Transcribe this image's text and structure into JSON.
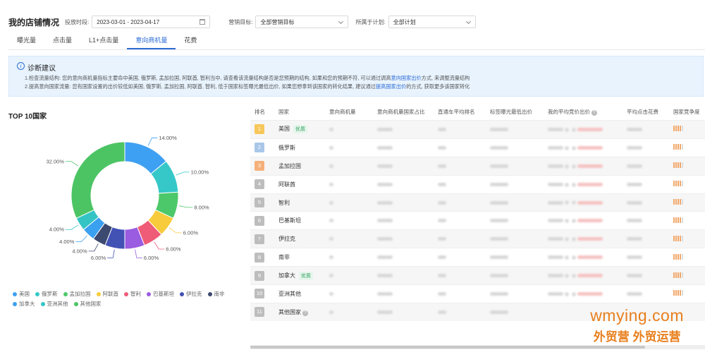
{
  "header": {
    "title": "我的店铺情况",
    "date_label": "投放时段:",
    "date_range": "2023-03-01 - 2023-04-17",
    "goal_label": "营销目标:",
    "goal_value": "全部营销目标",
    "plan_label": "所属于计划:",
    "plan_value": "全部计划"
  },
  "tabs": [
    {
      "label": "曝光量",
      "active": false
    },
    {
      "label": "点击量",
      "active": false
    },
    {
      "label": "L1+点击量",
      "active": false
    },
    {
      "label": "意向商机量",
      "active": true
    },
    {
      "label": "花费",
      "active": false
    }
  ],
  "alert": {
    "title": "诊断建议",
    "line1_a": "1.检查流量结构: 您的意向商机量指标主要命中美国, 俄罗斯, 孟加拉国, 阿联酋, 智利当中, 请查看该流量结构是否是您预期的结构, 如果和您的预期不符, 可以通过调高",
    "line1_link": "意向国家出价",
    "line1_b": "方式, 来调整流量结构",
    "line2_a": "2.提高意向国家流量: 您有国家设置的出价较低如美国, 俄罗斯, 孟加拉国, 阿联酋, 智利, 低于国家标签曝光最低出价, 如果您想拿到该国家的转化结果, 建议通过",
    "line2_link": "提高国家出价",
    "line2_b": "的方式, 获取更多该国家转化"
  },
  "chart_title": "TOP 10国家",
  "chart_data": {
    "type": "pie",
    "donut": true,
    "categories": [
      "美国",
      "俄罗斯",
      "孟加拉国",
      "阿联酋",
      "智利",
      "巴基斯坦",
      "伊拉克",
      "南非",
      "加拿大",
      "亚洲其他",
      "其他国家"
    ],
    "values": [
      14,
      10,
      8,
      6,
      6,
      6,
      6,
      4,
      4,
      4,
      32
    ],
    "labels": [
      "14.00%",
      "10.00%",
      "8.00%",
      "6.00%",
      "6.00%",
      "6.00%",
      "6.00%",
      "4.00%",
      "4.00%",
      "4.00%",
      "32.00%"
    ],
    "colors": [
      "#3ea0f3",
      "#36c8c8",
      "#4cc86a",
      "#f8cb3c",
      "#ee5c78",
      "#9a5ce0",
      "#4251b4",
      "#3c4a70",
      "#3aa0f0",
      "#34c4c4",
      "#4cc464"
    ]
  },
  "table": {
    "headers": [
      "排名",
      "国家",
      "意向商机量",
      "意向商机量国家占比",
      "直通车平均排名",
      "标签曝光最低出价",
      "我的平均竞价出价",
      "平均点击花费",
      "国家竞争度"
    ],
    "rows": [
      {
        "rank": "1",
        "country": "美国",
        "badge": "优质",
        "rank_color": "#f7c75a"
      },
      {
        "rank": "2",
        "country": "俄罗斯",
        "badge": "",
        "rank_color": "#a9c7e8"
      },
      {
        "rank": "3",
        "country": "孟加拉国",
        "badge": "",
        "rank_color": "#f5b07a"
      },
      {
        "rank": "4",
        "country": "阿联酋",
        "badge": "",
        "rank_color": "#bdbdbd"
      },
      {
        "rank": "5",
        "country": "智利",
        "badge": "",
        "rank_color": "#bdbdbd"
      },
      {
        "rank": "6",
        "country": "巴基斯坦",
        "badge": "",
        "rank_color": "#bdbdbd"
      },
      {
        "rank": "7",
        "country": "伊拉克",
        "badge": "",
        "rank_color": "#bdbdbd"
      },
      {
        "rank": "8",
        "country": "南非",
        "badge": "",
        "rank_color": "#bdbdbd"
      },
      {
        "rank": "9",
        "country": "加拿大",
        "badge": "优质",
        "rank_color": "#bdbdbd"
      },
      {
        "rank": "10",
        "country": "亚洲其他",
        "badge": "",
        "rank_color": "#bdbdbd"
      },
      {
        "rank": "11",
        "country": "其他国家",
        "badge": "",
        "rank_color": "#bdbdbd"
      }
    ]
  },
  "watermark": {
    "line1": "wmying.com",
    "line2": "外贸营 外贸运营"
  }
}
